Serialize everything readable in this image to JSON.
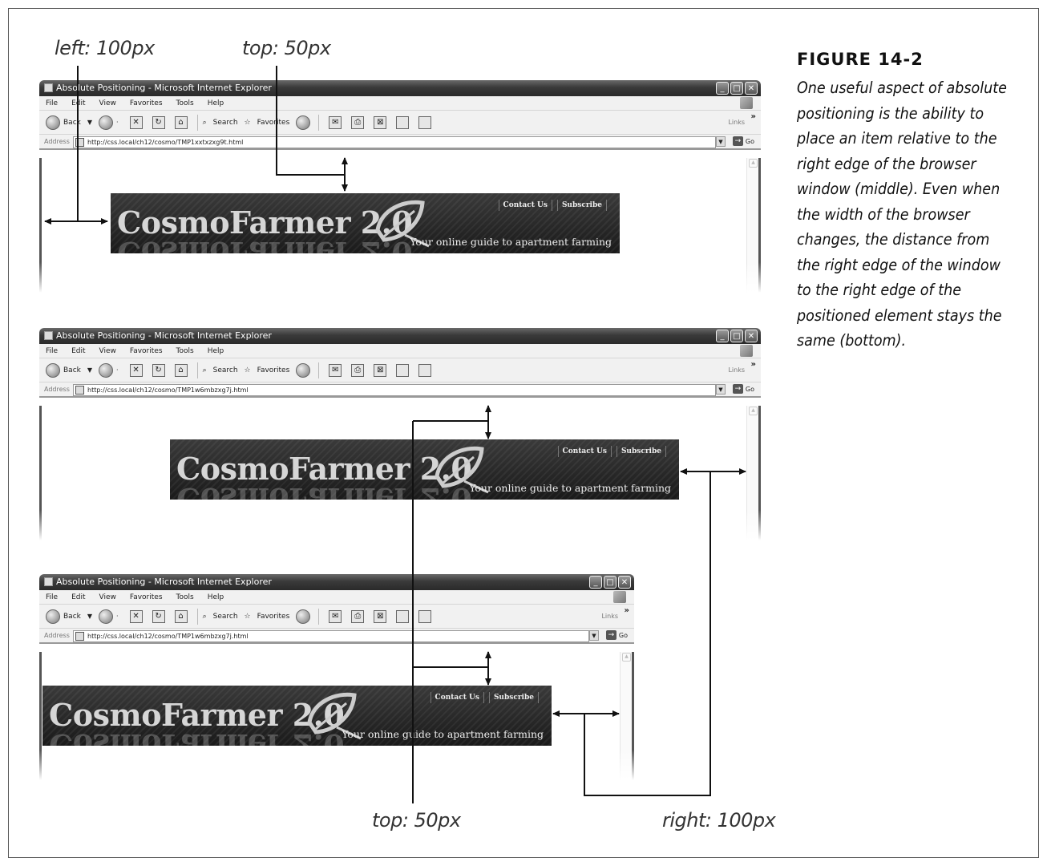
{
  "callouts": {
    "left": "left: 100px",
    "top_upper": "top: 50px",
    "top_lower": "top: 50px",
    "right": "right: 100px"
  },
  "figure": {
    "number": "FIGURE 14-2",
    "caption": "One useful aspect of absolute positioning is the ability to place an item relative to the right edge of the browser window (middle). Even when the width of the browser changes, the distance from the right edge of the window to the right edge of the positioned element stays the same (bottom)."
  },
  "browsers": [
    {
      "title": "Absolute Positioning - Microsoft Internet Explorer",
      "menu": [
        "File",
        "Edit",
        "View",
        "Favorites",
        "Tools",
        "Help"
      ],
      "toolbar": {
        "back": "Back",
        "search": "Search",
        "favorites": "Favorites",
        "links": "Links"
      },
      "address_label": "Address",
      "url": "http://css.local/ch12/cosmo/TMP1xxtxzxg9t.html",
      "go": "Go"
    },
    {
      "title": "Absolute Positioning - Microsoft Internet Explorer",
      "menu": [
        "File",
        "Edit",
        "View",
        "Favorites",
        "Tools",
        "Help"
      ],
      "toolbar": {
        "back": "Back",
        "search": "Search",
        "favorites": "Favorites",
        "links": "Links"
      },
      "address_label": "Address",
      "url": "http://css.local/ch12/cosmo/TMP1w6mbzxg7j.html",
      "go": "Go"
    },
    {
      "title": "Absolute Positioning - Microsoft Internet Explorer",
      "menu": [
        "File",
        "Edit",
        "View",
        "Favorites",
        "Tools",
        "Help"
      ],
      "toolbar": {
        "back": "Back",
        "search": "Search",
        "favorites": "Favorites",
        "links": "Links"
      },
      "address_label": "Address",
      "url": "http://css.local/ch12/cosmo/TMP1w6mbzxg7j.html",
      "go": "Go"
    }
  ],
  "banner": {
    "brand": "CosmoFarmer 2.0",
    "nav": [
      "Contact Us",
      "Subscribe"
    ],
    "tagline": "Your online guide to apartment farming"
  }
}
